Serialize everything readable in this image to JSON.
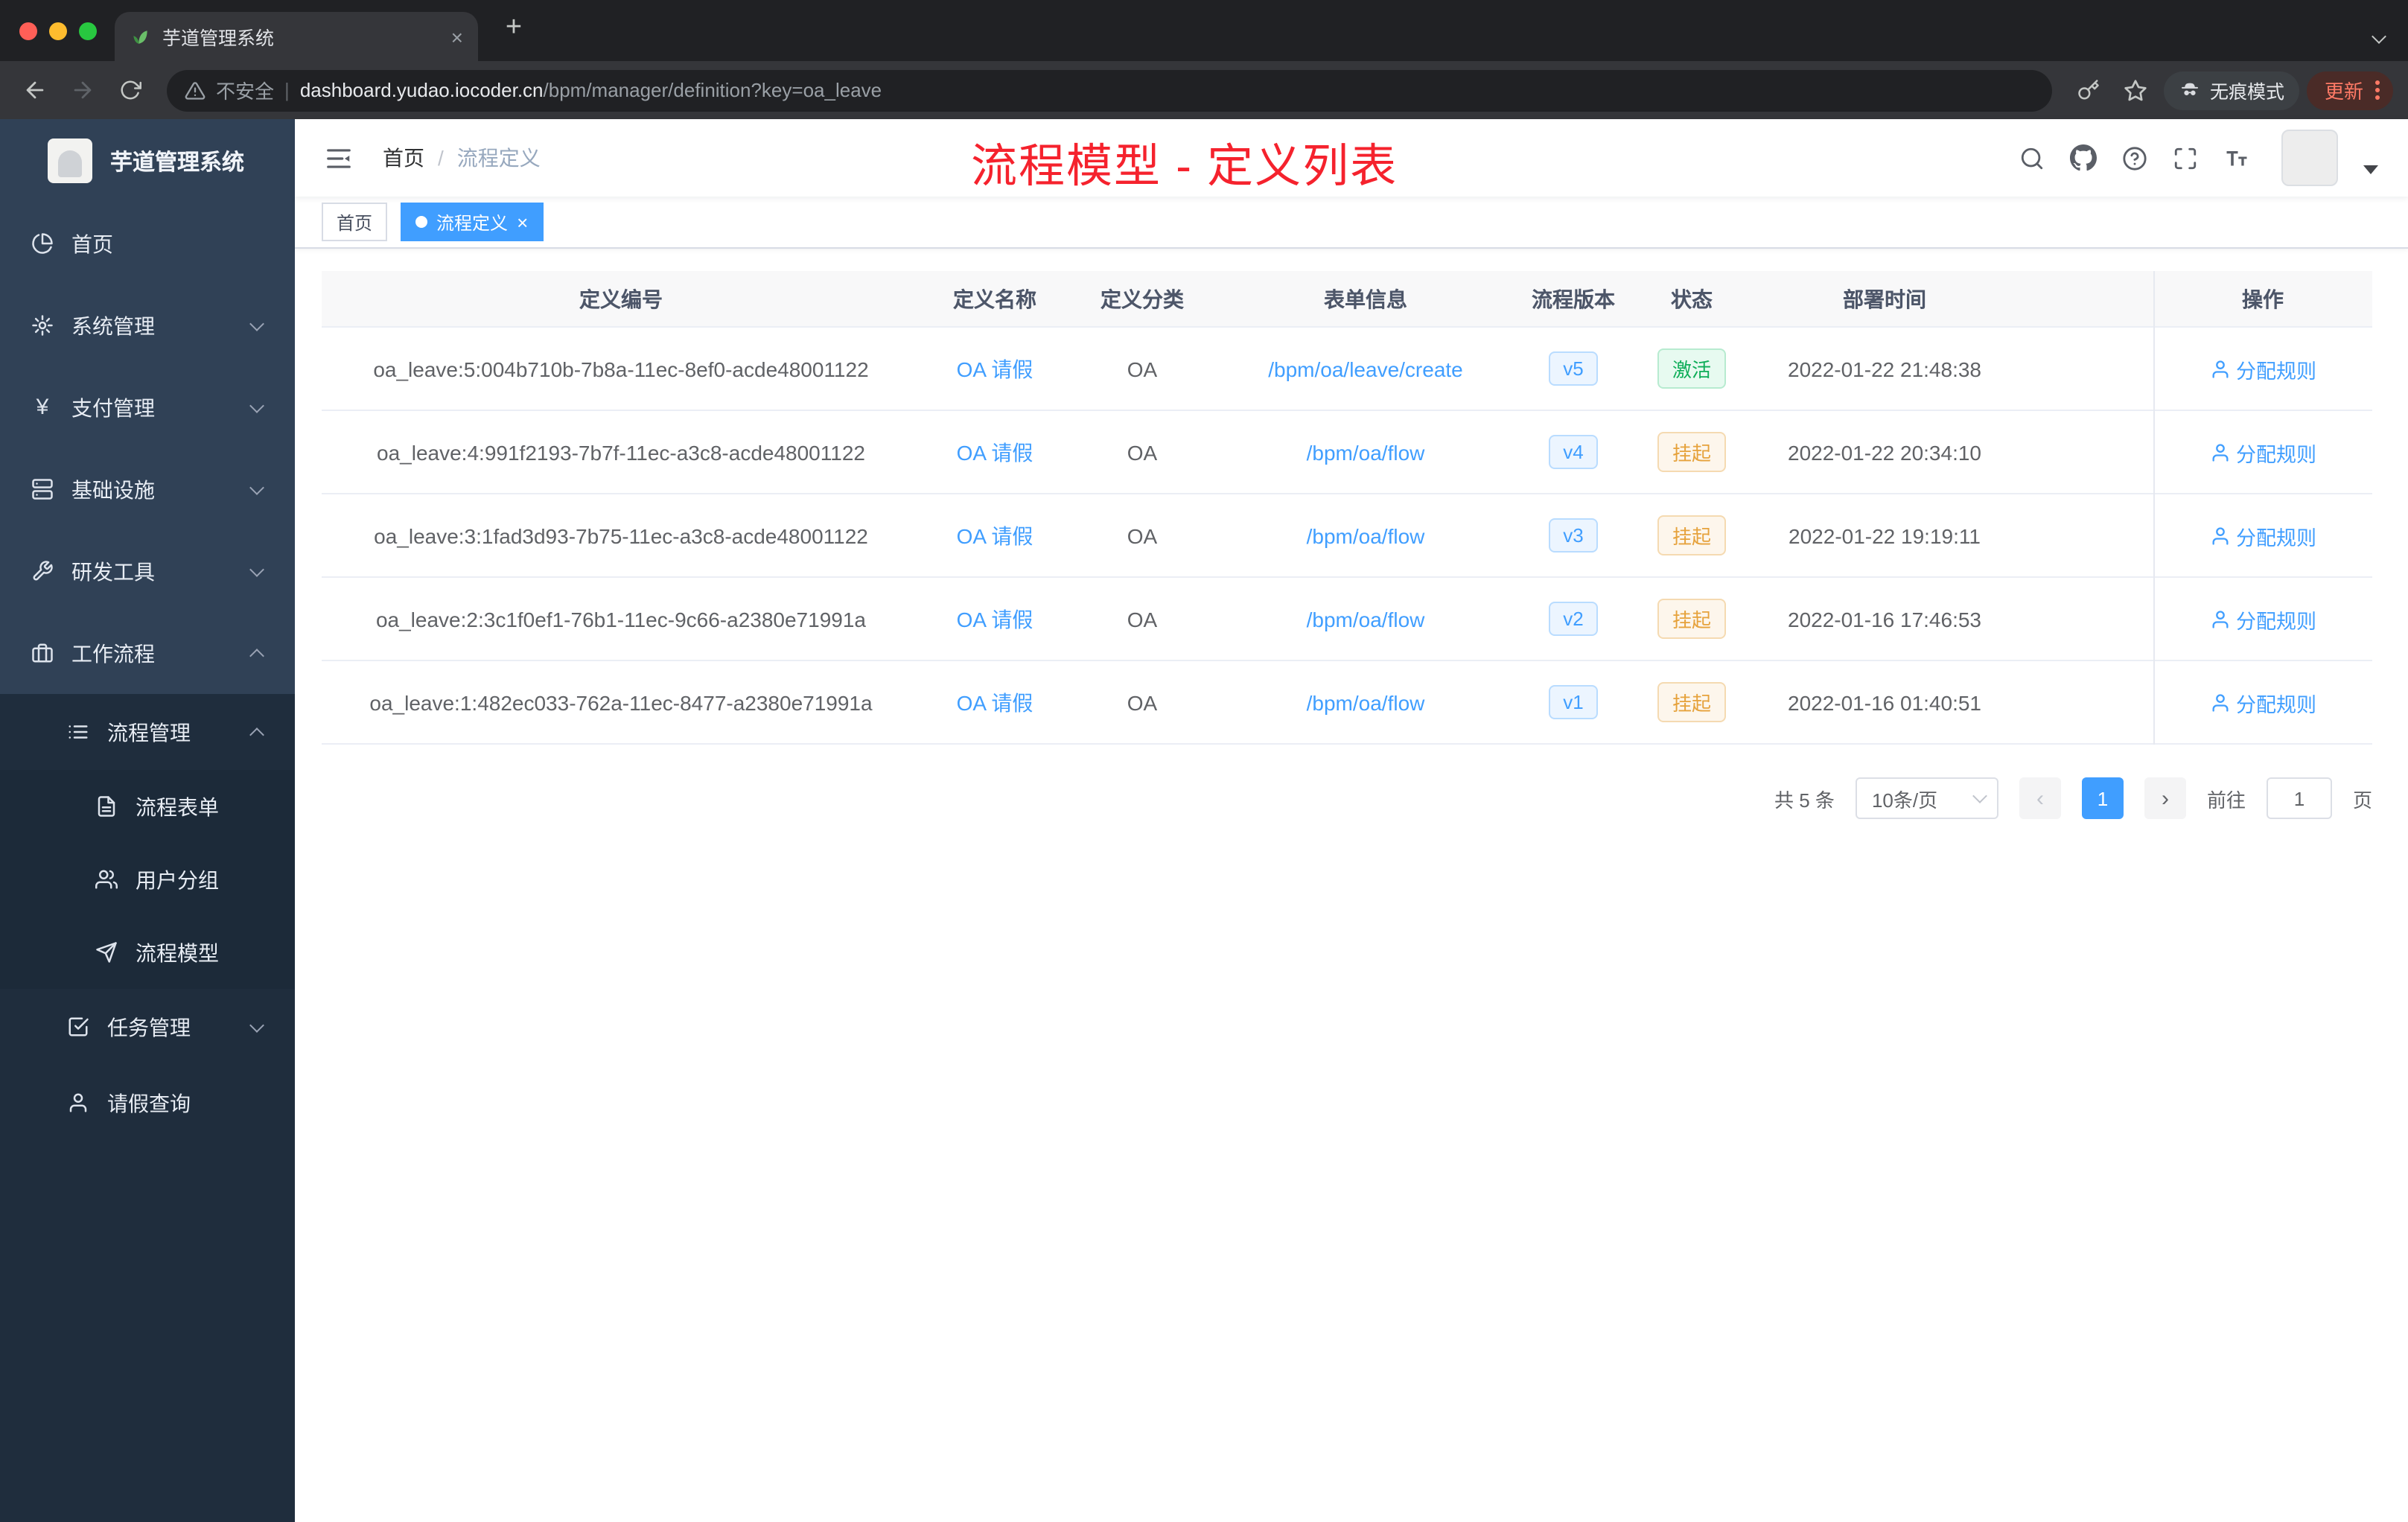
{
  "browser": {
    "tab_title": "芋道管理系统",
    "tab_close": "×",
    "new_tab_button": "+",
    "security_label": "不安全",
    "url_host": "dashboard.yudao.iocoder.cn",
    "url_path": "/bpm/manager/definition?key=oa_leave",
    "incognito_label": "无痕模式",
    "update_label": "更新"
  },
  "sidebar": {
    "logo_title": "芋道管理系统",
    "items": [
      {
        "label": "首页"
      },
      {
        "label": "系统管理"
      },
      {
        "label": "支付管理"
      },
      {
        "label": "基础设施"
      },
      {
        "label": "研发工具"
      },
      {
        "label": "工作流程"
      },
      {
        "label": "流程管理"
      },
      {
        "label": "流程表单"
      },
      {
        "label": "用户分组"
      },
      {
        "label": "流程模型"
      },
      {
        "label": "任务管理"
      },
      {
        "label": "请假查询"
      }
    ]
  },
  "header": {
    "breadcrumb_home": "首页",
    "breadcrumb_sep": "/",
    "breadcrumb_current": "流程定义",
    "annotation": "流程模型 - 定义列表"
  },
  "tags": {
    "home": "首页",
    "current": "流程定义",
    "close": "×"
  },
  "table": {
    "columns": {
      "id": "定义编号",
      "name": "定义名称",
      "category": "定义分类",
      "form": "表单信息",
      "version": "流程版本",
      "status": "状态",
      "deploy_time": "部署时间",
      "actions": "操作"
    },
    "rows": [
      {
        "id": "oa_leave:5:004b710b-7b8a-11ec-8ef0-acde48001122",
        "name": "OA 请假",
        "category": "OA",
        "form": "/bpm/oa/leave/create",
        "version": "v5",
        "status": "激活",
        "status_type": "success",
        "deploy_time": "2022-01-22 21:48:38",
        "action": "分配规则"
      },
      {
        "id": "oa_leave:4:991f2193-7b7f-11ec-a3c8-acde48001122",
        "name": "OA 请假",
        "category": "OA",
        "form": "/bpm/oa/flow",
        "version": "v4",
        "status": "挂起",
        "status_type": "warning",
        "deploy_time": "2022-01-22 20:34:10",
        "action": "分配规则"
      },
      {
        "id": "oa_leave:3:1fad3d93-7b75-11ec-a3c8-acde48001122",
        "name": "OA 请假",
        "category": "OA",
        "form": "/bpm/oa/flow",
        "version": "v3",
        "status": "挂起",
        "status_type": "warning",
        "deploy_time": "2022-01-22 19:19:11",
        "action": "分配规则"
      },
      {
        "id": "oa_leave:2:3c1f0ef1-76b1-11ec-9c66-a2380e71991a",
        "name": "OA 请假",
        "category": "OA",
        "form": "/bpm/oa/flow",
        "version": "v2",
        "status": "挂起",
        "status_type": "warning",
        "deploy_time": "2022-01-16 17:46:53",
        "action": "分配规则"
      },
      {
        "id": "oa_leave:1:482ec033-762a-11ec-8477-a2380e71991a",
        "name": "OA 请假",
        "category": "OA",
        "form": "/bpm/oa/flow",
        "version": "v1",
        "status": "挂起",
        "status_type": "warning",
        "deploy_time": "2022-01-16 01:40:51",
        "action": "分配规则"
      }
    ]
  },
  "pagination": {
    "total": "共 5 条",
    "page_size": "10条/页",
    "prev": "‹",
    "page": "1",
    "next": "›",
    "goto": "前往",
    "goto_value": "1",
    "unit": "页"
  },
  "colors": {
    "accent": "#409eff",
    "annotation_red": "#f5222d",
    "sidebar_bg": "#304156",
    "submenu_bg": "#1f2d3d",
    "status_active_text": "#0fae59",
    "status_suspend_text": "#e6a23c",
    "tag_active_bg": "#409eff"
  },
  "icons": {
    "favicon": "green-leaf",
    "toolbar": [
      "back",
      "forward",
      "reload",
      "warning-triangle",
      "key",
      "star",
      "incognito-spy",
      "menu-dots"
    ],
    "navbar": [
      "hamburger",
      "search",
      "github",
      "help-circle",
      "fullscreen",
      "font-size"
    ],
    "sidebar": [
      "pie-chart",
      "gear",
      "yen",
      "server",
      "wrench",
      "briefcase",
      "list",
      "file-text",
      "users",
      "paper-plane",
      "check-square",
      "user"
    ]
  }
}
